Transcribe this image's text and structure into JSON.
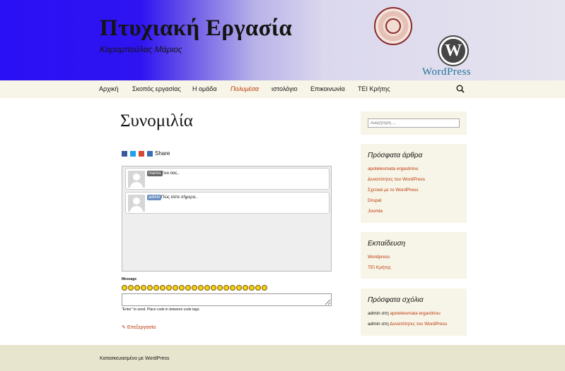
{
  "header": {
    "site_title": "Πτυχιακή Εργασία",
    "site_description": "Καραμπούλας Μάριος",
    "wordpress_logo_text": "WordPress",
    "wordpress_logo_glyph": "W"
  },
  "nav": {
    "items": [
      {
        "label": "Αρχική"
      },
      {
        "label": "Σκοπός εργασίας"
      },
      {
        "label": "Η ομάδα"
      },
      {
        "label": "Πολυμέσα"
      },
      {
        "label": "ιστολόγιο"
      },
      {
        "label": "Επικοινωνία"
      },
      {
        "label": "ΤΕΙ Κρήτης"
      }
    ],
    "active_item": "Πολυμέσα",
    "search_icon": "search-icon"
  },
  "main": {
    "page_title": "Συνομιλία",
    "share": {
      "label": "Share",
      "icons": [
        "facebook-icon",
        "twitter-icon",
        "google-plus-icon",
        "share-plus-icon"
      ]
    },
    "chat": {
      "messages": [
        {
          "name": "marios",
          "text": "Γεια σας..",
          "badge_color": "#666666"
        },
        {
          "name": "admin",
          "text": "Πώς είστε σήμερα..",
          "badge_color": "#6a8fc0"
        }
      ],
      "input_label": "Message",
      "hint": "\"Enter\" to send. Place code in between code tags.",
      "emoticon_count": 23
    },
    "edit_link": "Επεξεργασία"
  },
  "sidebar": {
    "search_placeholder": "Αναζήτηση ...",
    "recent_posts": {
      "title": "Πρόσφατα άρθρα",
      "items": [
        "apotelesmata ergastiriou",
        "Δυνατότητες του WordPress",
        "Σχετικά με το WordPress",
        "Drupal",
        "Joomla"
      ]
    },
    "education": {
      "title": "Εκπαίδευση",
      "items": [
        "Wordpress",
        "ΤΕΙ Κρήτης"
      ]
    },
    "recent_comments": {
      "title": "Πρόσφατα σχόλια",
      "items": [
        {
          "author": "admin",
          "connector": "στη",
          "post": "apotelesmata ergastiriou"
        },
        {
          "author": "admin",
          "connector": "στη",
          "post": "Δυνατότητες του WordPress"
        }
      ]
    }
  },
  "footer": {
    "text": "Κατασκευασμένο με WordPress"
  },
  "colors": {
    "link": "#bc360a",
    "nav_bg": "#f7f5e7",
    "footer_bg": "#e8e5ce",
    "header_left": "#2a10f5"
  }
}
